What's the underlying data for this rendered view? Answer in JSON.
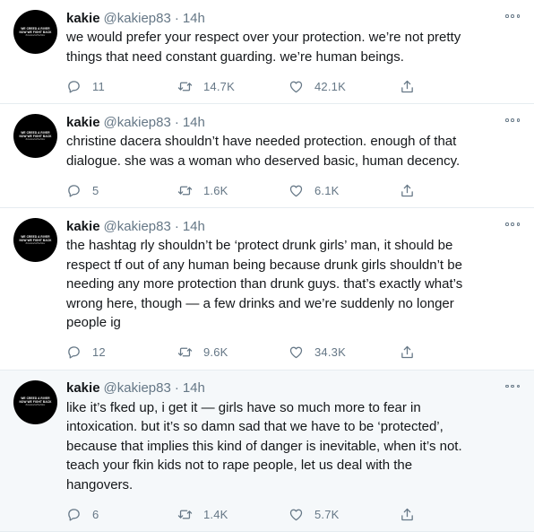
{
  "avatar": {
    "line1": "WE CREED A RIVER",
    "line2": "NOW WE FIGHT BACK",
    "line3": "#JusticeforHerMov"
  },
  "tweets": [
    {
      "name": "kakie",
      "handle": "@kakiep83",
      "dot": "·",
      "time": "14h",
      "text": "we would prefer your respect over your protection. we’re not pretty\nthings that need constant guarding. we’re human beings.",
      "replies": "11",
      "retweets": "14.7K",
      "likes": "42.1K"
    },
    {
      "name": "kakie",
      "handle": "@kakiep83",
      "dot": "·",
      "time": "14h",
      "text": "christine dacera shouldn’t have needed protection. enough of that\ndialogue. she was a woman who deserved basic, human decency.",
      "replies": "5",
      "retweets": "1.6K",
      "likes": "6.1K"
    },
    {
      "name": "kakie",
      "handle": "@kakiep83",
      "dot": "·",
      "time": "14h",
      "text": "the hashtag rly shouldn’t be ‘protect drunk girls’ man, it should be\nrespect tf out of any human being because drunk girls shouldn’t be\nneeding any more protection than drunk guys. that’s exactly what’s\nwrong here, though — a few drinks and we’re suddenly no longer\npeople ig",
      "replies": "12",
      "retweets": "9.6K",
      "likes": "34.3K"
    },
    {
      "name": "kakie",
      "handle": "@kakiep83",
      "dot": "·",
      "time": "14h",
      "text": "like it’s fked up, i get it — girls have so much more to fear in\nintoxication. but it’s so damn sad that we have to be ‘protected’,\nbecause that implies this kind of danger is inevitable, when it’s not.\nteach your fkin kids not to rape people, let us deal with the\nhangovers.",
      "replies": "6",
      "retweets": "1.4K",
      "likes": "5.7K"
    }
  ],
  "icons": {
    "more": "more-options-icon",
    "reply": "reply-icon",
    "retweet": "retweet-icon",
    "like": "like-icon",
    "share": "share-icon"
  },
  "colors": {
    "text": "#14171a",
    "secondary": "#657786",
    "divider": "#e6ecf0",
    "highlight_bg": "#f5f8fa"
  }
}
